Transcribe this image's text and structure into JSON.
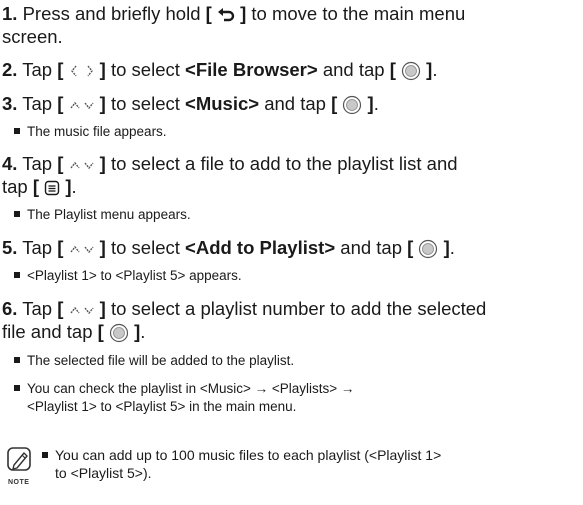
{
  "steps": [
    {
      "num": "1.",
      "line1_pre": "Press and briefly hold ",
      "bracket_open": "[",
      "bracket_close": "]",
      "line1_post": " to move to the main menu",
      "line2": "screen."
    },
    {
      "num": "2.",
      "pre": "Tap ",
      "bracket_open": "[",
      "bracket_close": "]",
      "mid": " to select ",
      "bold": "<File Browser>",
      "post": " and tap "
    },
    {
      "num": "3.",
      "pre": "Tap ",
      "bracket_open": "[",
      "bracket_close": "]",
      "mid": " to select ",
      "bold": "<Music>",
      "post": " and tap "
    },
    {
      "num": "4.",
      "pre": "Tap ",
      "bracket_open": "[",
      "bracket_close": "]",
      "mid": " to select a file to add to the playlist list and",
      "line2_pre": "tap "
    },
    {
      "num": "5.",
      "pre": "Tap ",
      "bracket_open": "[",
      "bracket_close": "]",
      "mid": " to select ",
      "bold": "<Add to Playlist>",
      "post": " and tap "
    },
    {
      "num": "6.",
      "pre": "Tap ",
      "bracket_open": "[",
      "bracket_close": "]",
      "mid": " to select a playlist number to add the selected",
      "line2_pre": "file and tap "
    }
  ],
  "subs": {
    "s3": "The music file appears.",
    "s4": "The Playlist menu appears.",
    "s5": "<Playlist 1> to <Playlist 5> appears.",
    "s6a": "The selected file will be added to the playlist.",
    "s6b_line1": "You can check the playlist in <Music> → <Playlists> →",
    "s6b_line2": "<Playlist 1> to <Playlist 5> in the main menu."
  },
  "note": {
    "label": "NOTE",
    "line1": "You can add up to 100 music files to each playlist (<Playlist 1>",
    "line2": "to <Playlist 5>)."
  },
  "icons": {
    "back": "back-icon",
    "left_right": "left-right-arrows-icon",
    "up_down": "up-down-arrows-icon",
    "select": "select-button-icon",
    "menu": "menu-icon",
    "note": "note-pencil-icon"
  }
}
